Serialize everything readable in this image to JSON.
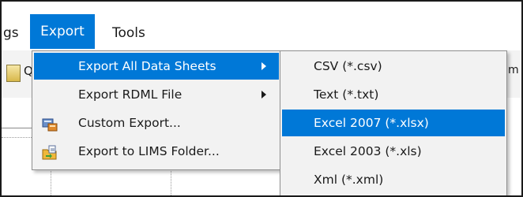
{
  "menubar": {
    "items": [
      {
        "label": "gs"
      },
      {
        "label": "Export"
      },
      {
        "label": "Tools"
      }
    ]
  },
  "toolbar": {
    "left_text": "Q",
    "right_text": "iscrim"
  },
  "export_menu": {
    "items": [
      {
        "label": "Export All Data Sheets",
        "has_submenu": true,
        "active": true
      },
      {
        "label": "Export RDML File",
        "has_submenu": true,
        "active": false
      },
      {
        "label": "Custom Export...",
        "icon": "custom-export-icon",
        "active": false
      },
      {
        "label": "Export to LIMS Folder...",
        "icon": "lims-folder-icon",
        "active": false
      }
    ]
  },
  "submenu": {
    "items": [
      {
        "label": "CSV (*.csv)",
        "active": false
      },
      {
        "label": "Text (*.txt)",
        "active": false
      },
      {
        "label": "Excel 2007 (*.xlsx)",
        "active": true
      },
      {
        "label": "Excel 2003 (*.xls)",
        "active": false
      },
      {
        "label": "Xml (*.xml)",
        "active": false
      }
    ]
  },
  "colors": {
    "highlight": "#0078d7",
    "menu_bg": "#f2f2f2",
    "text": "#1a1a1a"
  }
}
